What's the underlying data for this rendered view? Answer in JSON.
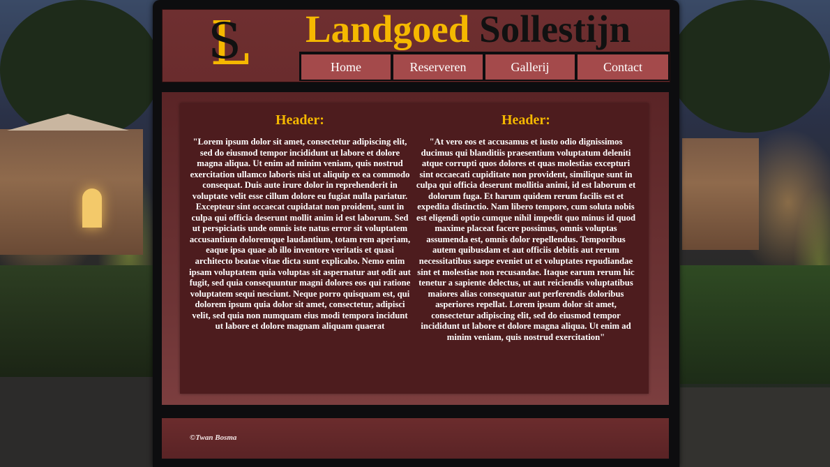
{
  "site": {
    "title_part1": "Landgoed",
    "title_part2": "Sollestijn",
    "logo_letters": "SL"
  },
  "nav": {
    "items": [
      {
        "label": "Home"
      },
      {
        "label": "Reserveren"
      },
      {
        "label": "Gallerij"
      },
      {
        "label": "Contact"
      }
    ]
  },
  "columns": [
    {
      "header": "Header:",
      "text": "\"Lorem ipsum dolor sit amet, consectetur adipiscing elit, sed do eiusmod tempor incididunt\nut labore et dolore magna aliqua. Ut enim ad minim veniam, quis nostrud exercitation\nullamco laboris nisi ut aliquip ex ea commodo consequat. Duis aute irure dolor in reprehenderit in voluptate velit esse cillum dolore eu fugiat nulla pariatur. Excepteur sint\noccaecat cupidatat non proident, sunt in culpa qui officia deserunt mollit anim id est laborum. Sed ut perspiciatis unde omnis iste natus error sit voluptatem accusantium doloremque laudantium, totam rem aperiam, eaque ipsa quae ab illo inventore veritatis et quasi architecto beatae vitae dicta sunt explicabo. Nemo enim ipsam voluptatem quia voluptas sit aspernatur aut odit aut fugit, sed quia consequuntur magni dolores eos qui ratione voluptatem sequi nesciunt. Neque porro quisquam est, qui dolorem ipsum quia dolor sit amet, consectetur, adipisci velit, sed quia non numquam eius modi tempora incidunt ut labore et dolore magnam aliquam quaerat"
    },
    {
      "header": "Header:",
      "text": "\"At vero eos et accusamus et iusto odio dignissimos ducimus qui blanditiis praesentium voluptatum deleniti atque corrupti quos dolores et quas molestias excepturi sint occaecati cupiditate non provident, similique sunt in culpa qui officia deserunt mollitia animi, id est laborum et dolorum fuga. Et harum quidem rerum facilis est et expedita distinctio. Nam libero tempore, cum soluta nobis est eligendi optio cumque nihil impedit quo minus id quod maxime placeat facere possimus, omnis voluptas assumenda est, omnis dolor repellendus. Temporibus autem quibusdam et aut officiis debitis aut rerum necessitatibus saepe eveniet ut et voluptates repudiandae sint et molestiae non recusandae. Itaque earum rerum hic tenetur a sapiente delectus, ut aut reiciendis voluptatibus maiores alias consequatur aut perferendis doloribus asperiores repellat. Lorem ipsum dolor sit amet, consectetur adipiscing elit, sed do eiusmod tempor incididunt\nut labore et dolore magna aliqua. Ut enim ad minim veniam, quis nostrud exercitation\""
    }
  ],
  "footer": {
    "copyright": "©Twan Bosma"
  },
  "colors": {
    "accent": "#f5b800",
    "nav_button": "#a44a4b",
    "panel": "#6e2f30",
    "content": "#4d1c1e"
  }
}
